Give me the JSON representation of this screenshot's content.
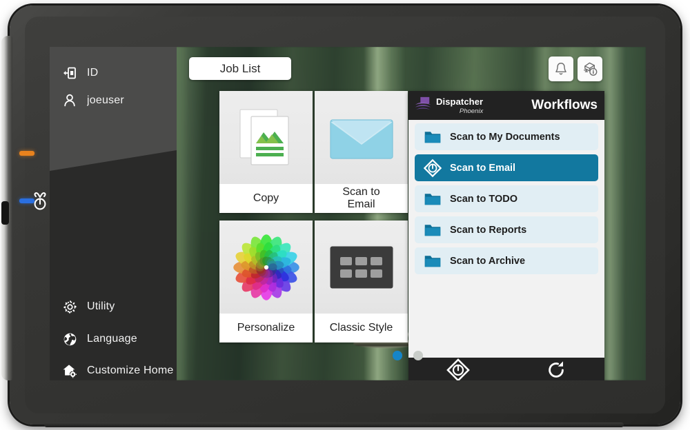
{
  "device": {
    "name": "MFP control panel tablet",
    "leds": [
      {
        "name": "status-led-orange",
        "color": "#e8821e"
      },
      {
        "name": "status-led-blue",
        "color": "#2a6fe0"
      }
    ],
    "power_button_icon": "power-button-icon"
  },
  "sidebar": {
    "items": [
      {
        "icon": "id-login-icon",
        "label": "ID"
      },
      {
        "icon": "user-icon",
        "label": "joeuser"
      },
      {
        "icon": "gear-icon",
        "label": "Utility"
      },
      {
        "icon": "globe-icon",
        "label": "Language"
      },
      {
        "icon": "home-settings-icon",
        "label": "Customize Home s"
      }
    ]
  },
  "topbar": {
    "job_list_label": "Job List",
    "icons": [
      {
        "name": "bell-icon",
        "title": "Notifications"
      },
      {
        "name": "mfp-info-icon",
        "title": "Machine information"
      }
    ]
  },
  "tiles": [
    {
      "id": "copy",
      "label": "Copy",
      "icon": "copy-documents-icon"
    },
    {
      "id": "scan-to-email",
      "label": "Scan to\nEmail",
      "line1": "Scan to",
      "line2": "Email",
      "icon": "envelope-icon"
    },
    {
      "id": "personalize",
      "label": "Personalize",
      "icon": "color-wheel-flower-icon"
    },
    {
      "id": "classic-style",
      "label": "Classic Style",
      "icon": "classic-grid-icon"
    }
  ],
  "workflows_panel": {
    "brand_name": "Dispatcher",
    "brand_sub": "Phoenix",
    "brand_logo_icon": "dispatcher-phoenix-logo-icon",
    "title": "Workflows",
    "selected_accent": "#12789f",
    "row_background": "#e1eef4",
    "items": [
      {
        "label": "Scan to My Documents",
        "icon": "folder-icon",
        "selected": false
      },
      {
        "label": "Scan to Email",
        "icon": "diamond-start-icon",
        "selected": true
      },
      {
        "label": "Scan to TODO",
        "icon": "folder-icon",
        "selected": false
      },
      {
        "label": "Scan to Reports",
        "icon": "folder-icon",
        "selected": false
      },
      {
        "label": "Scan to Archive",
        "icon": "folder-icon",
        "selected": false
      }
    ],
    "footer_buttons": [
      {
        "name": "start-diamond-button",
        "icon": "diamond-start-icon"
      },
      {
        "name": "refresh-button",
        "icon": "refresh-icon"
      }
    ]
  },
  "pagination": {
    "pages": 2,
    "active_index": 0,
    "active_color": "#1585c8",
    "inactive_color": "#c9cdc9"
  }
}
